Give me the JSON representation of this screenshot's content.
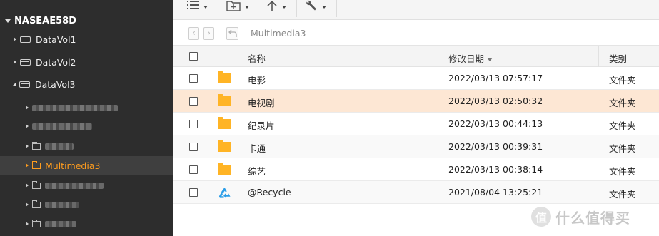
{
  "sidebar": {
    "root": {
      "label": "NASEAE58D",
      "expanded": true
    },
    "volumes": [
      {
        "label": "DataVol1",
        "expanded": false
      },
      {
        "label": "DataVol2",
        "expanded": false
      },
      {
        "label": "DataVol3",
        "expanded": true
      }
    ],
    "folders": [
      {
        "label": "",
        "blurred": true,
        "selected": false
      },
      {
        "label": "",
        "blurred": true,
        "selected": false
      },
      {
        "label": "",
        "blurred": true,
        "selected": false
      },
      {
        "label": "Multimedia3",
        "blurred": false,
        "selected": true
      },
      {
        "label": "",
        "blurred": true,
        "selected": false
      },
      {
        "label": "",
        "blurred": true,
        "selected": false
      },
      {
        "label": "",
        "blurred": true,
        "selected": false
      }
    ]
  },
  "toolbar": {
    "buttons": [
      "view-mode",
      "new-folder",
      "upload",
      "tools"
    ]
  },
  "pathbar": {
    "path": "Multimedia3"
  },
  "table": {
    "headers": {
      "name": "名称",
      "modified": "修改日期",
      "type": "类别"
    },
    "sort": {
      "column": "modified",
      "direction": "descending"
    },
    "rows": [
      {
        "name": "电影",
        "modified": "2022/03/13 07:57:17",
        "type": "文件夹",
        "icon": "folder-icon",
        "highlighted": false
      },
      {
        "name": "电视剧",
        "modified": "2022/03/13 02:50:32",
        "type": "文件夹",
        "icon": "folder-icon",
        "highlighted": true
      },
      {
        "name": "纪录片",
        "modified": "2022/03/13 00:44:13",
        "type": "文件夹",
        "icon": "folder-icon",
        "highlighted": false
      },
      {
        "name": "卡通",
        "modified": "2022/03/13 00:39:31",
        "type": "文件夹",
        "icon": "folder-icon",
        "highlighted": false
      },
      {
        "name": "综艺",
        "modified": "2022/03/13 00:38:14",
        "type": "文件夹",
        "icon": "folder-icon",
        "highlighted": false
      },
      {
        "name": "@Recycle",
        "modified": "2021/08/04 13:25:21",
        "type": "文件夹",
        "icon": "recycle-icon",
        "highlighted": false
      }
    ]
  },
  "watermark": {
    "logo": "值",
    "text": "什么值得买"
  },
  "colors": {
    "accent": "#ff9d1f",
    "folder": "#ffb425",
    "highlight_row": "#fde7d4",
    "sidebar_bg": "#2d2d2d",
    "recycle": "#2a9de8"
  }
}
